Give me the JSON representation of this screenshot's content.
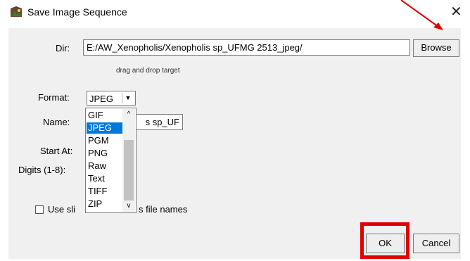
{
  "window": {
    "title": "Save Image Sequence",
    "app_icon": "imagej-icon",
    "close_icon": "close-icon"
  },
  "dir": {
    "label": "Dir:",
    "value": "E:/AW_Xenopholis/Xenopholis sp_UFMG 2513_jpeg/",
    "browse_label": "Browse",
    "hint": "drag and drop target"
  },
  "format": {
    "label": "Format:",
    "selected": "JPEG",
    "options": [
      "GIF",
      "JPEG",
      "PGM",
      "PNG",
      "Raw",
      "Text",
      "TIFF",
      "ZIP"
    ],
    "selected_index": 1
  },
  "name": {
    "label": "Name:",
    "value_visible": "s sp_UF"
  },
  "start_at": {
    "label": "Start At:"
  },
  "digits": {
    "label": "Digits (1-8):"
  },
  "use_slice": {
    "label_left": "Use sli",
    "label_right": "s file names",
    "checked": false
  },
  "buttons": {
    "ok_label": "OK",
    "cancel_label": "Cancel"
  },
  "annotation": {
    "color": "#e10000"
  }
}
